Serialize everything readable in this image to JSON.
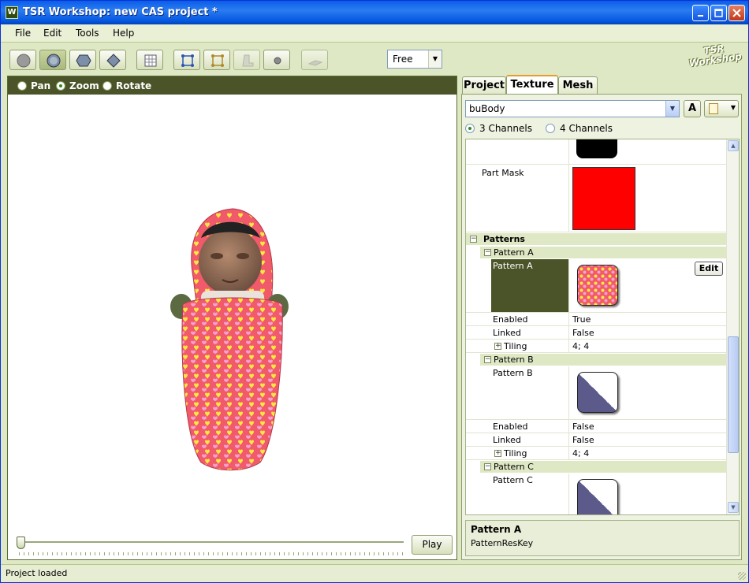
{
  "window": {
    "title": "TSR Workshop: new CAS project *",
    "app_icon_letter": "W"
  },
  "menubar": {
    "items": [
      "File",
      "Edit",
      "Tools",
      "Help"
    ]
  },
  "toolbar": {
    "view_mode_select": "Free",
    "logo_text_1": "TSR",
    "logo_text_2": "Workshop"
  },
  "viewport": {
    "nav_modes": [
      {
        "label": "Pan",
        "selected": false
      },
      {
        "label": "Zoom",
        "selected": true
      },
      {
        "label": "Rotate",
        "selected": false
      }
    ],
    "play_label": "Play"
  },
  "panel": {
    "tabs": [
      {
        "label": "Project",
        "active": false
      },
      {
        "label": "Texture",
        "active": true
      },
      {
        "label": "Mesh",
        "active": false
      }
    ],
    "texture_combo": "buBody",
    "a_button": "A",
    "channels": [
      {
        "label": "3 Channels",
        "selected": true
      },
      {
        "label": "4 Channels",
        "selected": false
      }
    ],
    "grid": {
      "part_mask_label": "Part Mask",
      "patterns_label": "Patterns",
      "pattern_a": {
        "header": "Pattern A",
        "name": "Pattern A",
        "edit_label": "Edit",
        "rows": [
          {
            "label": "Enabled",
            "value": "True"
          },
          {
            "label": "Linked",
            "value": "False"
          },
          {
            "label": "Tiling",
            "value": "4; 4"
          }
        ]
      },
      "pattern_b": {
        "header": "Pattern B",
        "name": "Pattern B",
        "rows": [
          {
            "label": "Enabled",
            "value": "False"
          },
          {
            "label": "Linked",
            "value": "False"
          },
          {
            "label": "Tiling",
            "value": "4; 4"
          }
        ]
      },
      "pattern_c": {
        "header": "Pattern C",
        "name": "Pattern C"
      }
    },
    "description": {
      "title": "Pattern A",
      "text": "PatternResKey"
    }
  },
  "statusbar": {
    "text": "Project loaded"
  },
  "colors": {
    "accent_dark": "#4a5428",
    "part_mask": "#ff0000",
    "titlebar": "#0a5ee8"
  }
}
